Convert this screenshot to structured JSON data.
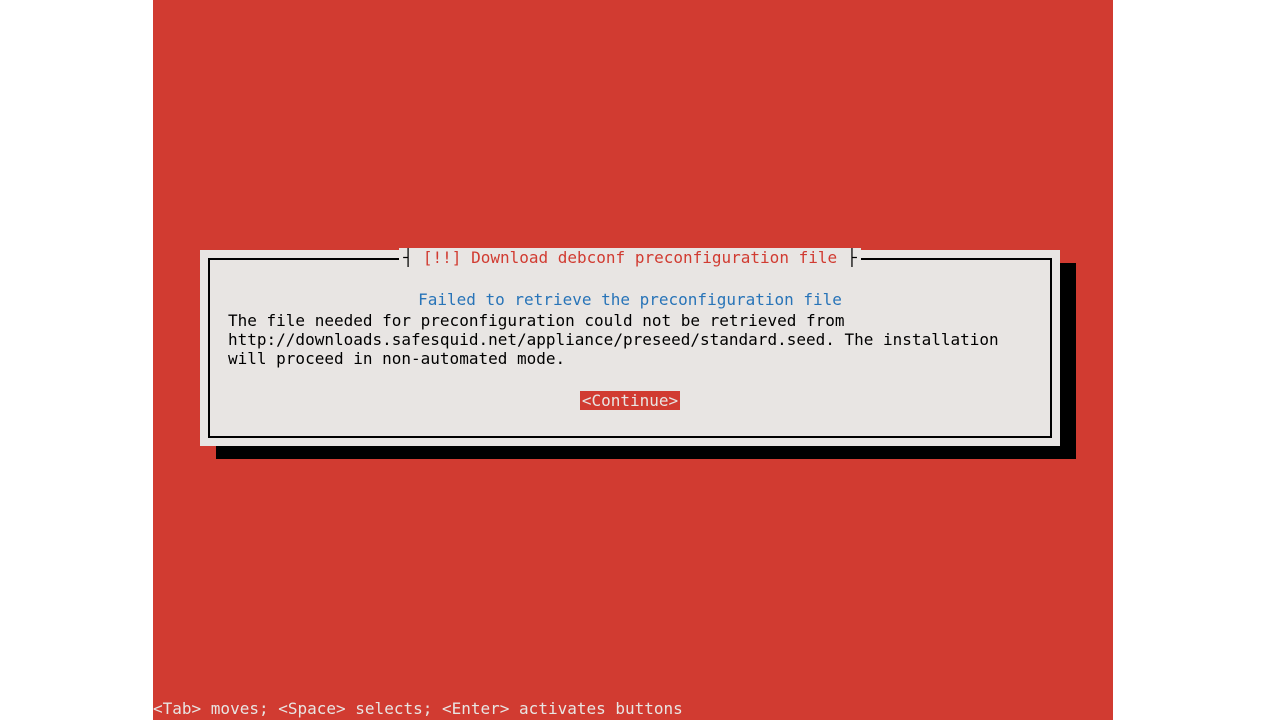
{
  "dialog": {
    "title_prefix": "[!!]",
    "title_text": "Download debconf preconfiguration file",
    "error_heading": "Failed to retrieve the preconfiguration file",
    "message": "The file needed for preconfiguration could not be retrieved from http://downloads.safesquid.net/appliance/preseed/standard.seed. The installation will proceed in non-automated mode.",
    "continue_label": "<Continue>"
  },
  "status_bar": {
    "text": "<Tab> moves; <Space> selects; <Enter> activates buttons"
  }
}
